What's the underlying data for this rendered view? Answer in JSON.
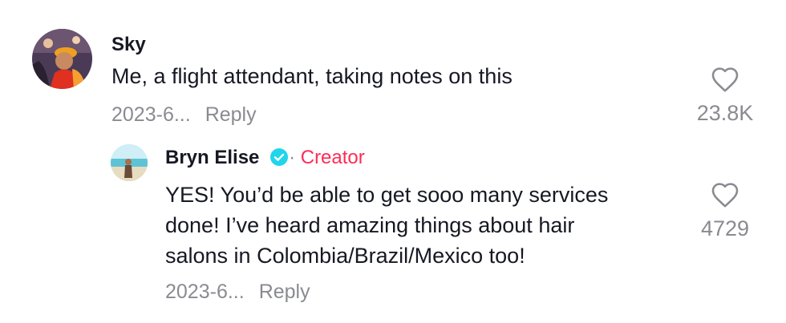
{
  "comments": [
    {
      "username": "Sky",
      "text": "Me, a flight attendant, taking notes on this",
      "date": "2023-6...",
      "reply_label": "Reply",
      "likes": "23.8K",
      "avatar_icon": "user-avatar-photo"
    },
    {
      "username": "Bryn Elise",
      "verified": true,
      "badge_separator": "·",
      "badge_label": "Creator",
      "text_lines": [
        "YES! You’d be able to get sooo many services",
        "done! I’ve heard amazing things about hair",
        "salons in Colombia/Brazil/Mexico too!"
      ],
      "date": "2023-6...",
      "reply_label": "Reply",
      "likes": "4729",
      "avatar_icon": "creator-avatar-photo"
    }
  ],
  "icons": {
    "like": "heart-outline-icon",
    "verified": "verified-check-icon"
  },
  "colors": {
    "primary_text": "#161823",
    "secondary_text": "#8a8b91",
    "creator_accent": "#fe2c55",
    "verified_blue": "#20d5ec"
  }
}
